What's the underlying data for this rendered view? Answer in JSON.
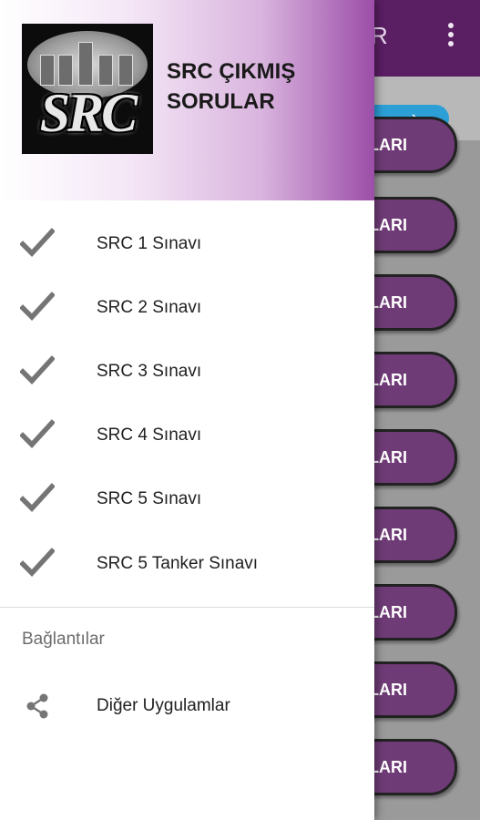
{
  "background": {
    "toolbar_title_fragment": "R",
    "banner_button_glyph": "›",
    "list_fragments": [
      "ULARI",
      "LARI",
      "RULARI",
      "LARI",
      "ULARI",
      "LARI",
      "ULARI",
      "LARI",
      "ULARI"
    ]
  },
  "drawer": {
    "header": {
      "logo_text": "SRC",
      "app_title_line1": "SRC ÇIKMIŞ",
      "app_title_line2": "SORULAR"
    },
    "items": [
      {
        "label": "SRC 1 Sınavı",
        "icon": "check-icon"
      },
      {
        "label": "SRC 2 Sınavı",
        "icon": "check-icon"
      },
      {
        "label": "SRC 3 Sınavı",
        "icon": "check-icon"
      },
      {
        "label": "SRC 4 Sınavı",
        "icon": "check-icon"
      },
      {
        "label": "SRC 5 Sınavı",
        "icon": "check-icon"
      },
      {
        "label": "SRC 5 Tanker Sınavı",
        "icon": "check-icon"
      }
    ],
    "section_title": "Bağlantılar",
    "links": [
      {
        "label": "Diğer Uygulamlar",
        "icon": "share-icon"
      }
    ]
  },
  "colors": {
    "toolbar": "#5a1e63",
    "accent": "#9c4ea8",
    "pill": "#6f3b77",
    "banner_button": "#2b9fd6"
  }
}
